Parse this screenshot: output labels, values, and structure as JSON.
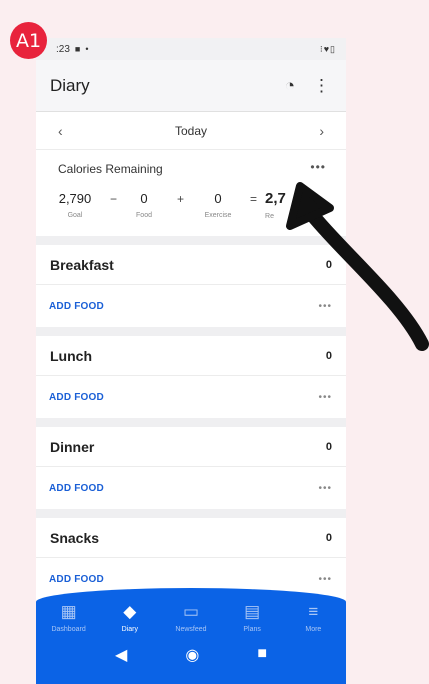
{
  "badge": "A1",
  "status": {
    "time": ":23"
  },
  "appbar": {
    "title": "Diary"
  },
  "date": {
    "label": "Today",
    "prev": "‹",
    "next": "›"
  },
  "calories": {
    "heading": "Calories Remaining",
    "goal": {
      "value": "2,790",
      "label": "Goal"
    },
    "food": {
      "value": "0",
      "label": "Food"
    },
    "exercise": {
      "value": "0",
      "label": "Exercise"
    },
    "remaining": {
      "value": "2,7",
      "label": "Re"
    },
    "op_minus": "−",
    "op_plus": "+",
    "op_equals": "="
  },
  "meals": [
    {
      "name": "Breakfast",
      "calories": "0",
      "add_label": "ADD FOOD"
    },
    {
      "name": "Lunch",
      "calories": "0",
      "add_label": "ADD FOOD"
    },
    {
      "name": "Dinner",
      "calories": "0",
      "add_label": "ADD FOOD"
    },
    {
      "name": "Snacks",
      "calories": "0",
      "add_label": "ADD FOOD"
    }
  ],
  "tabs": [
    {
      "label": "Dashboard",
      "icon": "dashboard-icon"
    },
    {
      "label": "Diary",
      "icon": "diary-icon"
    },
    {
      "label": "Newsfeed",
      "icon": "newsfeed-icon"
    },
    {
      "label": "Plans",
      "icon": "plans-icon"
    },
    {
      "label": "More",
      "icon": "menu-icon"
    }
  ],
  "colors": {
    "accent": "#0b63e6",
    "badge": "#e8233c",
    "link": "#1a5fd6"
  }
}
